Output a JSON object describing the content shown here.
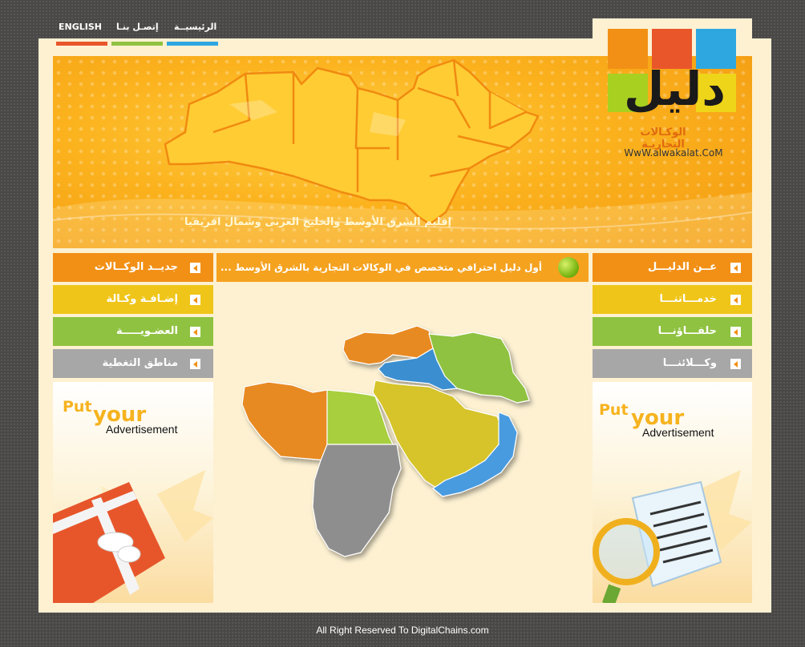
{
  "topnav": {
    "english": "ENGLISH",
    "contact": "إتصـل بنـا",
    "home": "الرئيسيــة"
  },
  "logo": {
    "wordmark": "دليل",
    "subtitle": "الوكـالات التجاريـة",
    "url": "WwW.alwakalat.CoM"
  },
  "banner": {
    "caption": "إقليم الشرق الأوسط والخليج العربى وشمال افريقيا"
  },
  "ticker": {
    "text": "أول دليل احترافي متخصص في الوكالات التجارية بالشرق الأوسط ..."
  },
  "left_menu": [
    {
      "label": "جديــد الوكــالات",
      "color": "#f29016"
    },
    {
      "label": "إضـافـة وكـالة",
      "color": "#efc51a"
    },
    {
      "label": "العضـويـــــة",
      "color": "#8fc241"
    },
    {
      "label": "مناطق التغطية",
      "color": "#a7a7a7"
    }
  ],
  "right_menu": [
    {
      "label": "عــن الدليـــل",
      "color": "#f29016"
    },
    {
      "label": "خدمـــاتنـــا",
      "color": "#efc51a"
    },
    {
      "label": "حلفـــاؤنـــا",
      "color": "#8fc241"
    },
    {
      "label": "وكـــلائنـــا",
      "color": "#a7a7a7"
    }
  ],
  "ads": {
    "put": "Put",
    "your": "your",
    "advertisement": "Advertisement"
  },
  "footer": {
    "text": "All Right Reserved To DigitalChains.com"
  },
  "colors": {
    "nav_bar_1": "#e8562a",
    "nav_bar_2": "#8fc241",
    "nav_bar_3": "#2ea7e0",
    "logo_orange": "#f29016",
    "logo_red": "#e8562a",
    "logo_blue": "#2ea7e0",
    "logo_green": "#a8d021",
    "logo_yellow": "#efd51a"
  }
}
